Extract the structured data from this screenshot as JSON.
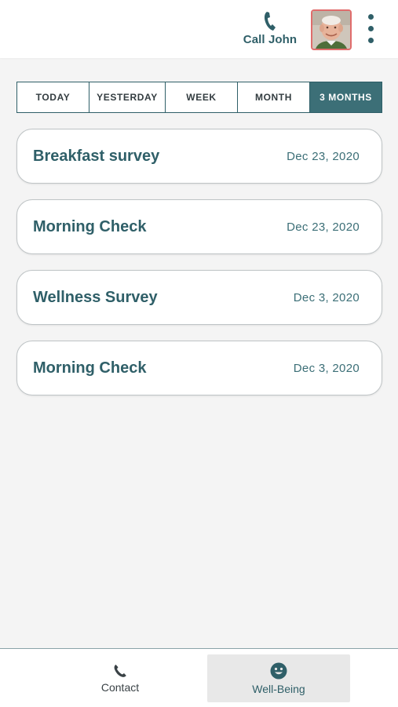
{
  "header": {
    "call_label": "Call John",
    "call_icon": "phone-icon",
    "avatar_icon": "avatar-photo",
    "menu_icon": "more-vertical-icon"
  },
  "tabs": [
    {
      "label": "TODAY",
      "active": false
    },
    {
      "label": "YESTERDAY",
      "active": false
    },
    {
      "label": "WEEK",
      "active": false
    },
    {
      "label": "MONTH",
      "active": false
    },
    {
      "label": "3 MONTHS",
      "active": true
    }
  ],
  "surveys": [
    {
      "title": "Breakfast survey",
      "date": "Dec 23, 2020"
    },
    {
      "title": "Morning Check",
      "date": "Dec 23, 2020"
    },
    {
      "title": "Wellness Survey",
      "date": "Dec 3, 2020"
    },
    {
      "title": "Morning Check",
      "date": "Dec 3, 2020"
    }
  ],
  "bottom_nav": [
    {
      "label": "Contact",
      "icon": "phone-icon",
      "active": false
    },
    {
      "label": "Well-Being",
      "icon": "smiley-icon",
      "active": true
    }
  ],
  "colors": {
    "accent": "#3c6f77",
    "text": "#2f5f68",
    "avatar_border": "#e06c6c",
    "background": "#f4f4f4"
  }
}
